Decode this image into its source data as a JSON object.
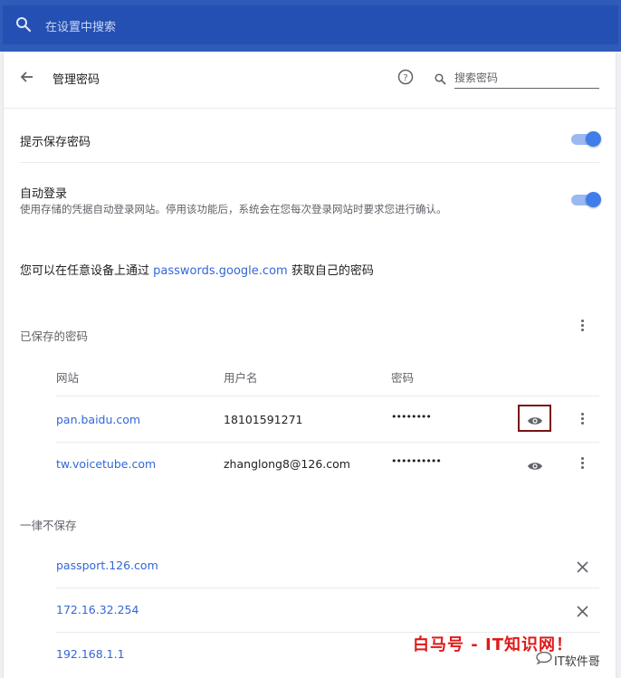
{
  "top_search": {
    "placeholder": "在设置中搜索",
    "icon": "search-icon"
  },
  "header": {
    "back_icon": "arrow-back-icon",
    "title": "管理密码",
    "help_icon": "help-circle-icon",
    "search_icon": "search-icon",
    "search_placeholder": "搜索密码"
  },
  "offer_to_save": {
    "label": "提示保存密码",
    "enabled": true
  },
  "auto_signin": {
    "label": "自动登录",
    "description": "使用存储的凭据自动登录网站。停用该功能后，系统会在您每次登录网站时要求您进行确认。",
    "enabled": true
  },
  "account_text": {
    "prefix": "您可以在任意设备上通过 ",
    "link": "passwords.google.com",
    "suffix": " 获取自己的密码"
  },
  "saved_passwords": {
    "title": "已保存的密码",
    "columns": {
      "site": "网站",
      "username": "用户名",
      "password": "密码"
    },
    "rows": [
      {
        "site": "pan.baidu.com",
        "username": "18101591271",
        "password": "••••••••"
      },
      {
        "site": "tw.voicetube.com",
        "username": "zhanglong8@126.com",
        "password": "••••••••••"
      }
    ]
  },
  "never_saved": {
    "title": "一律不保存",
    "sites": [
      "passport.126.com",
      "172.16.32.254",
      "192.168.1.1"
    ]
  },
  "colors": {
    "accent": "#3367d6",
    "topbar": "#2f5bb9",
    "highlight": "#7a1212"
  },
  "watermark": {
    "text": "白马号 - IT知识网！",
    "sub": "IT软件哥"
  }
}
